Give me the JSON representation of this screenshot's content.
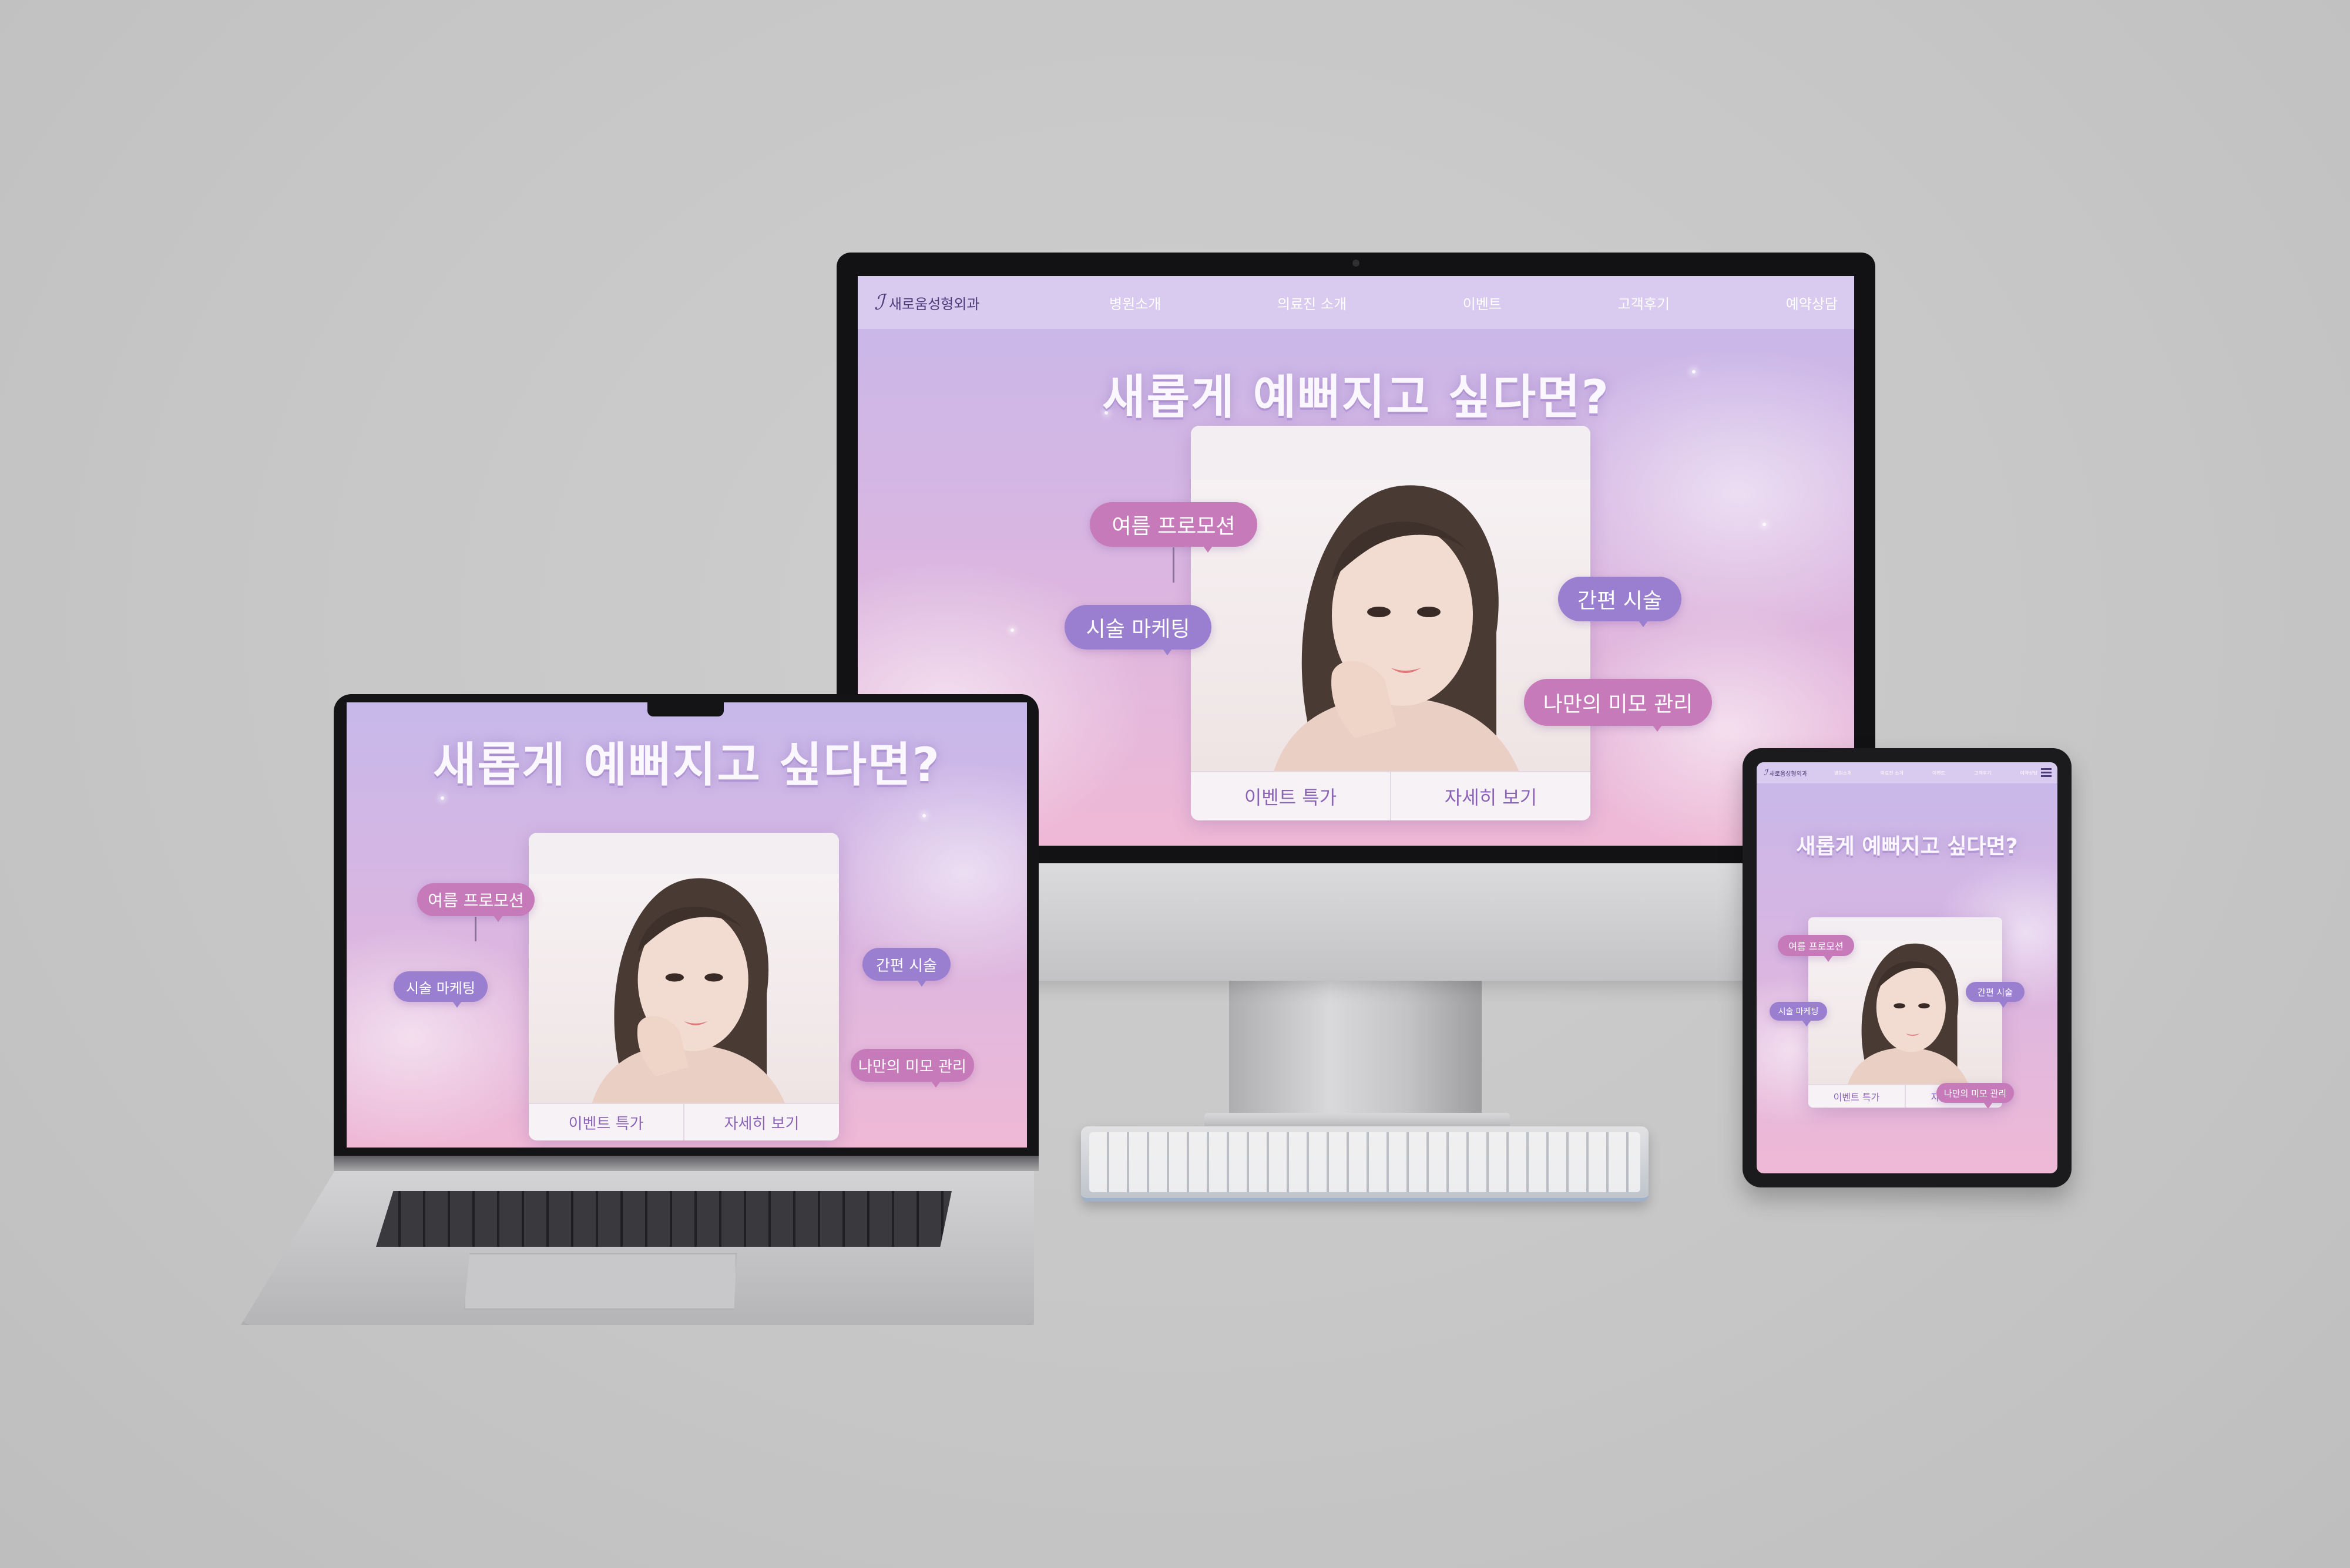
{
  "site": {
    "brand": "새로움성형외과",
    "nav": [
      "병원소개",
      "의료진 소개",
      "이벤트",
      "고객후기",
      "예약상담"
    ],
    "headline": "새롭게 예뻐지고 싶다면?",
    "bubbles": {
      "summer": "여름 프로모션",
      "marketing": "시술 마케팅",
      "simple": "간편 시술",
      "beauty": "나만의 미모 관리"
    },
    "buttons": {
      "event": "이벤트 특가",
      "detail": "자세히 보기"
    }
  },
  "colors": {
    "background": "#c6c6c6",
    "bubble_pink": "#c77ab9",
    "bubble_purple": "#9a7fd0",
    "accent_text": "#8b64b8"
  },
  "icons": [
    "hamburger-menu-icon",
    "webcam-dot-icon"
  ]
}
